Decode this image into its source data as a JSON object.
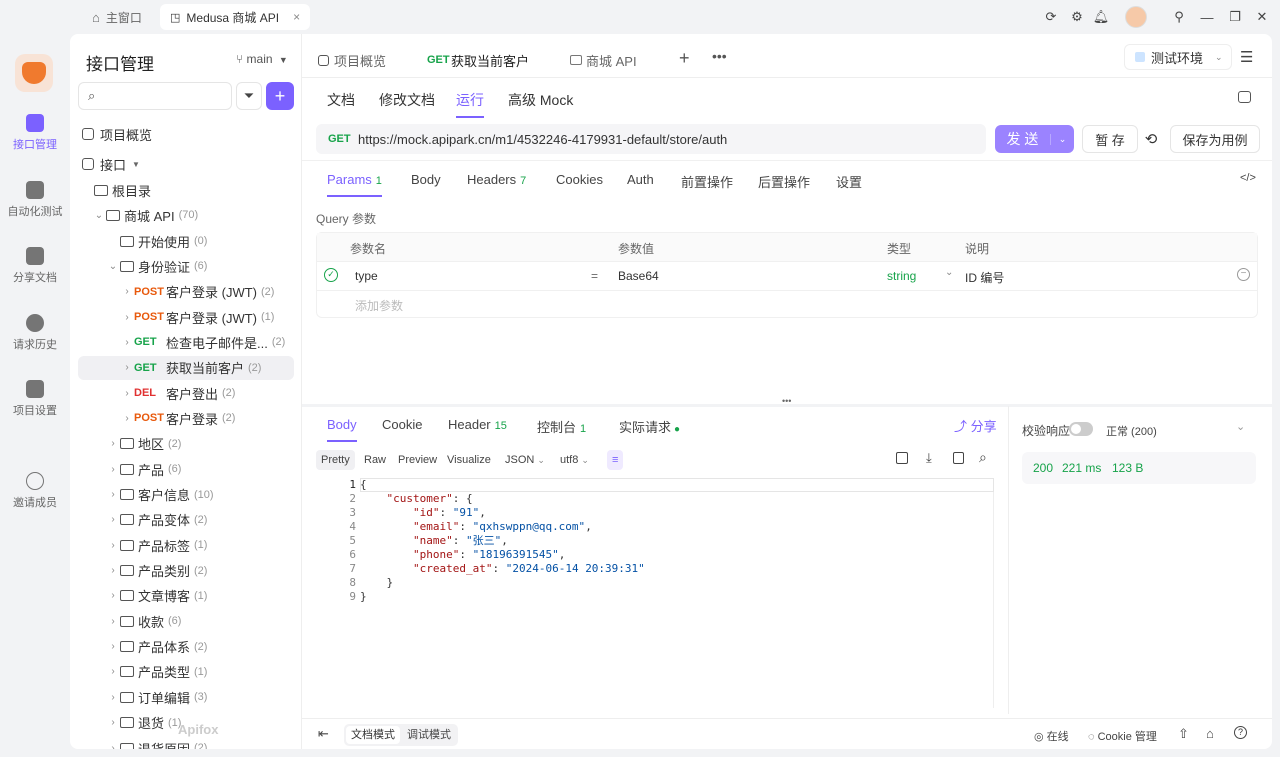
{
  "window_tabs": [
    {
      "label": "主窗口",
      "icon": "home-icon"
    },
    {
      "label": "Medusa 商城 API",
      "icon": "app-icon"
    }
  ],
  "rail": [
    {
      "label": "接口管理",
      "icon": "api-icon",
      "active": true
    },
    {
      "label": "自动化测试",
      "icon": "automation-icon"
    },
    {
      "label": "分享文档",
      "icon": "share-doc-icon"
    },
    {
      "label": "请求历史",
      "icon": "history-icon"
    },
    {
      "label": "项目设置",
      "icon": "settings-icon"
    },
    {
      "label": "邀请成员",
      "icon": "invite-icon"
    }
  ],
  "sidebar": {
    "title": "接口管理",
    "branch": "main",
    "overview": "项目概览",
    "api_root": "接口",
    "root_dir": "根目录",
    "shop_api": {
      "label": "商城 API",
      "count": "(70)"
    },
    "items": [
      {
        "type": "folder",
        "label": "开始使用",
        "count": "(0)",
        "indent": 1
      },
      {
        "type": "folder",
        "label": "身份验证",
        "count": "(6)",
        "indent": 1,
        "open": true
      },
      {
        "type": "api",
        "method": "POST",
        "label": "客户登录 (JWT)",
        "count": "(2)"
      },
      {
        "type": "api",
        "method": "POST",
        "label": "客户登录 (JWT)",
        "count": "(1)"
      },
      {
        "type": "api",
        "method": "GET",
        "label": "检查电子邮件是...",
        "count": "(2)"
      },
      {
        "type": "api",
        "method": "GET",
        "label": "获取当前客户",
        "count": "(2)",
        "selected": true
      },
      {
        "type": "api",
        "method": "DEL",
        "label": "客户登出",
        "count": "(2)"
      },
      {
        "type": "api",
        "method": "POST",
        "label": "客户登录",
        "count": "(2)"
      },
      {
        "type": "folder",
        "label": "地区",
        "count": "(2)"
      },
      {
        "type": "folder",
        "label": "产品",
        "count": "(6)"
      },
      {
        "type": "folder",
        "label": "客户信息",
        "count": "(10)"
      },
      {
        "type": "folder",
        "label": "产品变体",
        "count": "(2)"
      },
      {
        "type": "folder",
        "label": "产品标签",
        "count": "(1)"
      },
      {
        "type": "folder",
        "label": "产品类别",
        "count": "(2)"
      },
      {
        "type": "folder",
        "label": "文章博客",
        "count": "(1)"
      },
      {
        "type": "folder",
        "label": "收款",
        "count": "(6)"
      },
      {
        "type": "folder",
        "label": "产品体系",
        "count": "(2)"
      },
      {
        "type": "folder",
        "label": "产品类型",
        "count": "(1)"
      },
      {
        "type": "folder",
        "label": "订单编辑",
        "count": "(3)"
      },
      {
        "type": "folder",
        "label": "退货",
        "count": "(1)"
      },
      {
        "type": "folder",
        "label": "退货原因",
        "count": "(2)"
      }
    ],
    "watermark": "Apifox"
  },
  "tabs": [
    {
      "label": "项目概览",
      "icon": "overview-icon"
    },
    {
      "method": "GET",
      "label": "获取当前客户",
      "active": true
    },
    {
      "label": "商城 API",
      "icon": "folder-icon"
    }
  ],
  "env": "测试环境",
  "subtabs": [
    "文档",
    "修改文档",
    "运行",
    "高级 Mock"
  ],
  "request": {
    "method": "GET",
    "url": "https://mock.apipark.cn/m1/4532246-4179931-default/store/auth",
    "send": "发 送",
    "save_temp": "暂 存",
    "save_case": "保存为用例"
  },
  "param_tabs": [
    {
      "label": "Params",
      "badge": "1",
      "active": true
    },
    {
      "label": "Body"
    },
    {
      "label": "Headers",
      "badge": "7"
    },
    {
      "label": "Cookies"
    },
    {
      "label": "Auth"
    },
    {
      "label": "前置操作"
    },
    {
      "label": "后置操作"
    },
    {
      "label": "设置"
    }
  ],
  "query": {
    "title": "Query 参数",
    "headers": [
      "参数名",
      "参数值",
      "类型",
      "说明"
    ],
    "row": {
      "name": "type",
      "eq": "=",
      "value": "Base64",
      "type": "string",
      "desc": "ID 编号"
    },
    "add_placeholder": "添加参数"
  },
  "response_tabs": [
    {
      "label": "Body",
      "active": true
    },
    {
      "label": "Cookie"
    },
    {
      "label": "Header",
      "badge": "15"
    },
    {
      "label": "控制台",
      "badge": "1"
    },
    {
      "label": "实际请求",
      "dot": true
    }
  ],
  "share": "分享",
  "view_modes": [
    "Pretty",
    "Raw",
    "Preview",
    "Visualize"
  ],
  "format": "JSON",
  "encoding": "utf8",
  "code_lines": [
    "{",
    "    \"customer\": {",
    "        \"id\": \"91\",",
    "        \"email\": \"qxhswppn@qq.com\",",
    "        \"name\": \"张三\",",
    "        \"phone\": \"18196391545\",",
    "        \"created_at\": \"2024-06-14 20:39:31\"",
    "    }",
    "}"
  ],
  "validate": {
    "label": "校验响应",
    "status": "正常 (200)"
  },
  "stats": {
    "code": "200",
    "time": "221 ms",
    "size": "123 B"
  },
  "footer": {
    "doc_mode": "文档模式",
    "debug_mode": "调试模式",
    "online": "在线",
    "cookie": "Cookie 管理"
  },
  "colors": {
    "accent": "#7b61ff",
    "post": "#e8590c",
    "get": "#17a34a",
    "del": "#e03131"
  }
}
